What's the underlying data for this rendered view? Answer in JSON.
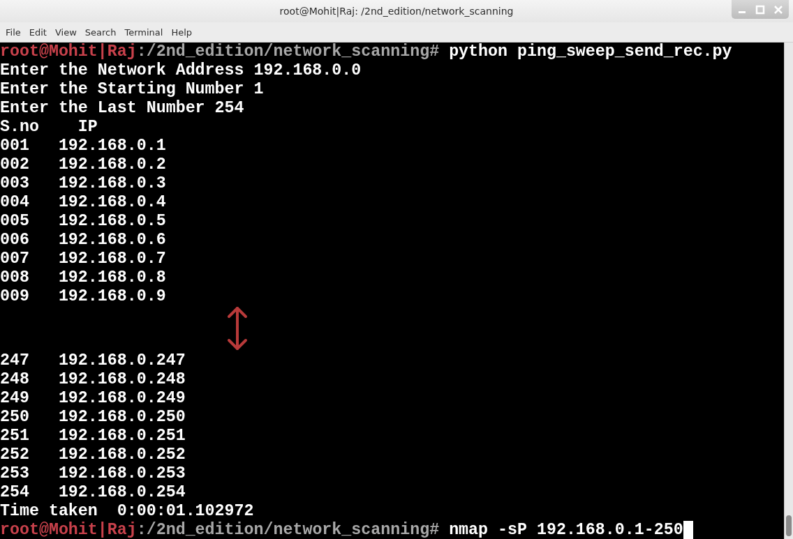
{
  "window": {
    "title": "root@Mohit|Raj: /2nd_edition/network_scanning"
  },
  "menu": [
    "File",
    "Edit",
    "View",
    "Search",
    "Terminal",
    "Help"
  ],
  "terminal": {
    "lines": [
      {
        "kind": "prompt",
        "user": "root@Mohit|Raj",
        "path": ":/2nd_edition/network_scanning#",
        "command": "python ping_sweep_send_rec.py",
        "cursor": false
      },
      {
        "kind": "text",
        "text": "Enter the Network Address 192.168.0.0"
      },
      {
        "kind": "text",
        "text": "Enter the Starting Number 1"
      },
      {
        "kind": "text",
        "text": "Enter the Last Number 254"
      },
      {
        "kind": "header",
        "sno": "S.no",
        "ip": "IP"
      },
      {
        "kind": "row",
        "sno": "001",
        "ip": "192.168.0.1"
      },
      {
        "kind": "row",
        "sno": "002",
        "ip": "192.168.0.2"
      },
      {
        "kind": "row",
        "sno": "003",
        "ip": "192.168.0.3"
      },
      {
        "kind": "row",
        "sno": "004",
        "ip": "192.168.0.4"
      },
      {
        "kind": "row",
        "sno": "005",
        "ip": "192.168.0.5"
      },
      {
        "kind": "row",
        "sno": "006",
        "ip": "192.168.0.6"
      },
      {
        "kind": "row",
        "sno": "007",
        "ip": "192.168.0.7"
      },
      {
        "kind": "row",
        "sno": "008",
        "ip": "192.168.0.8"
      },
      {
        "kind": "row",
        "sno": "009",
        "ip": "192.168.0.9"
      },
      {
        "kind": "gap"
      },
      {
        "kind": "row",
        "sno": "247",
        "ip": "192.168.0.247"
      },
      {
        "kind": "row",
        "sno": "248",
        "ip": "192.168.0.248"
      },
      {
        "kind": "row",
        "sno": "249",
        "ip": "192.168.0.249"
      },
      {
        "kind": "row",
        "sno": "250",
        "ip": "192.168.0.250"
      },
      {
        "kind": "row",
        "sno": "251",
        "ip": "192.168.0.251"
      },
      {
        "kind": "row",
        "sno": "252",
        "ip": "192.168.0.252"
      },
      {
        "kind": "row",
        "sno": "253",
        "ip": "192.168.0.253"
      },
      {
        "kind": "row",
        "sno": "254",
        "ip": "192.168.0.254"
      },
      {
        "kind": "text",
        "text": "Time taken  0:00:01.102972"
      },
      {
        "kind": "prompt",
        "user": "root@Mohit|Raj",
        "path": ":/2nd_edition/network_scanning#",
        "command": "nmap -sP 192.168.0.1-250",
        "cursor": true
      }
    ]
  }
}
